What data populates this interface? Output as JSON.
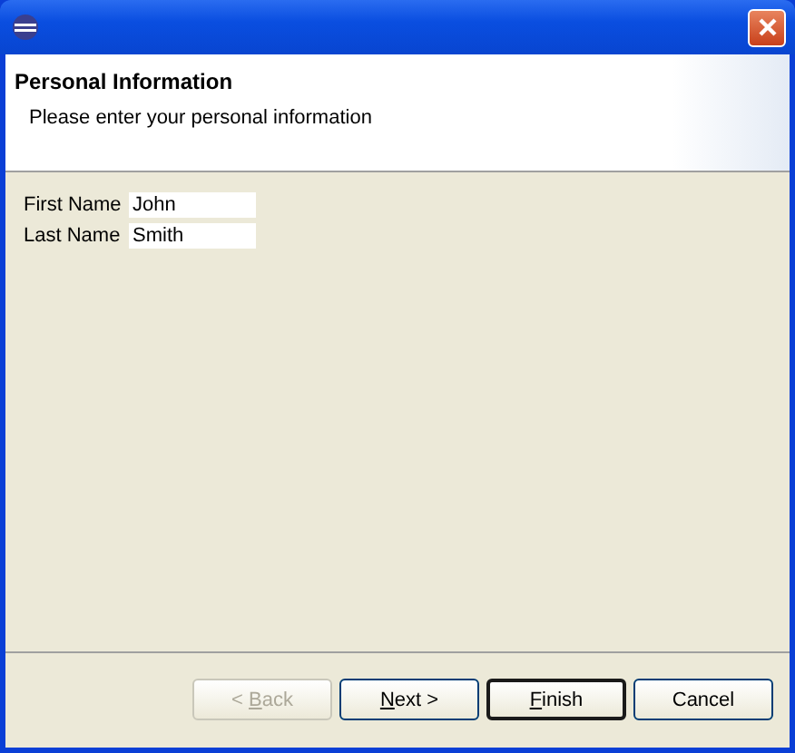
{
  "header": {
    "title": "Personal Information",
    "message": "Please enter your personal information"
  },
  "fields": [
    {
      "label": "First Name",
      "value": "John"
    },
    {
      "label": "Last Name",
      "value": "Smith"
    }
  ],
  "buttons": [
    {
      "before": "< ",
      "key": "B",
      "after": "ack",
      "disabled": true,
      "default": false
    },
    {
      "key": "N",
      "after": "ext >",
      "disabled": false,
      "default": false
    },
    {
      "key": "F",
      "after": "inish",
      "disabled": false,
      "default": true
    },
    {
      "before": "Cancel",
      "disabled": false,
      "default": false
    }
  ]
}
